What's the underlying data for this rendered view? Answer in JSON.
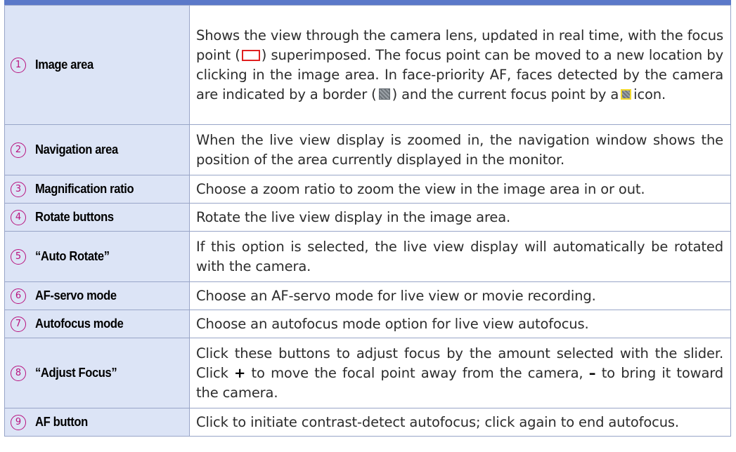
{
  "rows": [
    {
      "num": "1",
      "label": "Image area",
      "desc": {
        "part1": "Shows the view through the camera lens, updated in real time, with the focus point (",
        "part2": ") superimposed. The focus point can be moved to a new location by clicking in the image area. In face-priority AF, faces detected by the camera are indicated by a border (",
        "part3": ") and the current focus point by a",
        "part4": "icon."
      }
    },
    {
      "num": "2",
      "label": "Navigation area",
      "desc": "When the live view display is zoomed in, the navigation window shows the position of the area currently displayed in the monitor."
    },
    {
      "num": "3",
      "label": "Magnification ratio",
      "desc": "Choose a zoom ratio to zoom the view in the image area in or out."
    },
    {
      "num": "4",
      "label": "Rotate buttons",
      "desc": "Rotate the live view display in the image area."
    },
    {
      "num": "5",
      "label": "“Auto Rotate”",
      "desc": "If this option is selected, the live view display will automatically be rotated with the camera."
    },
    {
      "num": "6",
      "label": "AF-servo mode",
      "desc": "Choose an AF-servo mode for live view or movie recording."
    },
    {
      "num": "7",
      "label": "Autofocus mode",
      "desc": "Choose an autofocus mode option for live view autofocus."
    },
    {
      "num": "8",
      "label": "“Adjust Focus”",
      "desc": {
        "part1": "Click these buttons to adjust focus by the amount selected with the slider. Click",
        "plus": "+",
        "part2": "to move the focal point away from the camera,",
        "minus": "–",
        "part3": "to bring it toward the camera."
      }
    },
    {
      "num": "9",
      "label": "AF button",
      "desc": "Click to initiate contrast-detect autofocus; click again to end autofocus."
    }
  ],
  "icons": {
    "focus_point": "focus-point-icon",
    "face_border": "face-border-icon",
    "current_focus": "current-focus-point-icon"
  },
  "colors": {
    "header_bar": "#5b79c9",
    "label_bg": "#dce4f6",
    "number_accent": "#b8127e",
    "border": "#98a5c8"
  }
}
